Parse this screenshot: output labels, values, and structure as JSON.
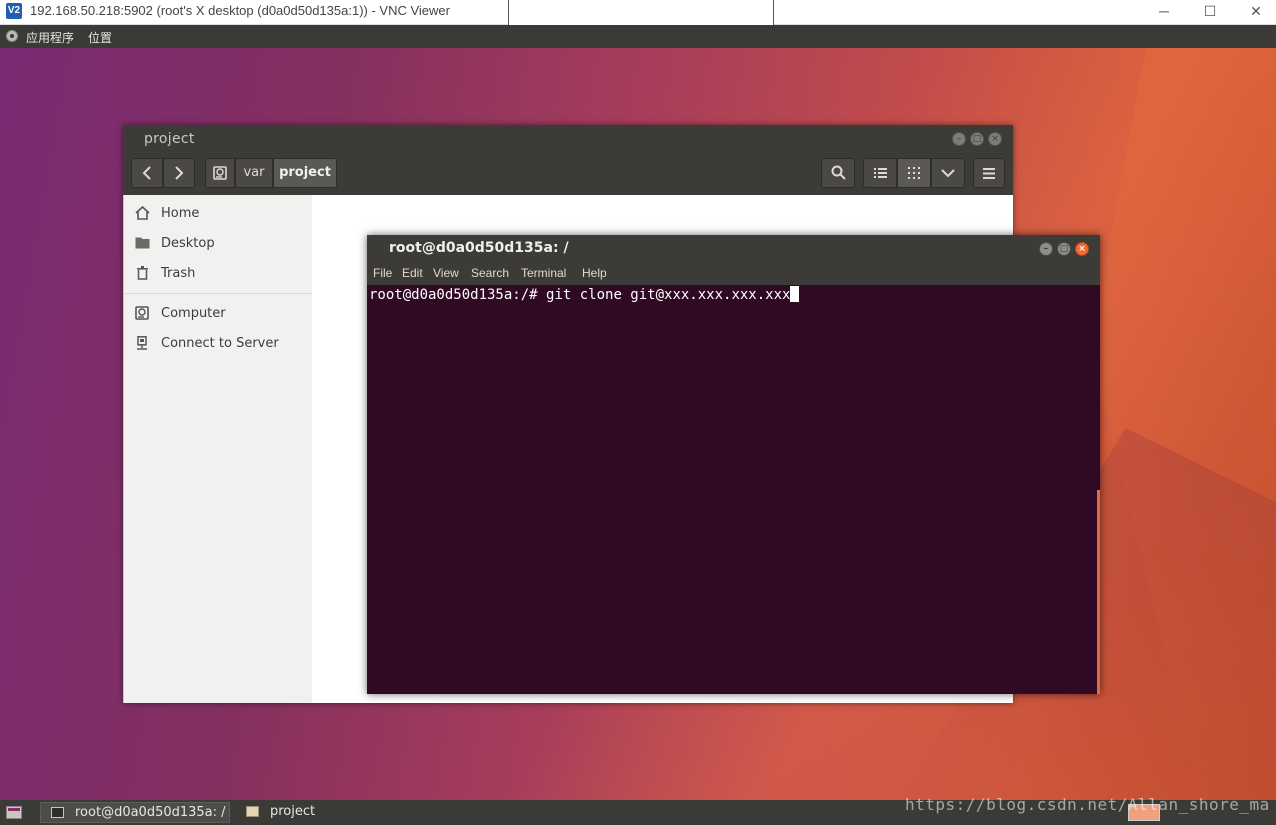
{
  "vnc": {
    "logo": "V2",
    "title": "192.168.50.218:5902 (root's X desktop (d0a0d50d135a:1)) - VNC Viewer",
    "minimize": "─",
    "maximize": "☐",
    "close": "✕"
  },
  "top_panel": {
    "applications": "应用程序",
    "places": "位置"
  },
  "file_manager": {
    "title": "project",
    "path": {
      "segment_1": "var",
      "segment_2": "project"
    },
    "sidebar": [
      {
        "label": "Home",
        "icon": "home-icon"
      },
      {
        "label": "Desktop",
        "icon": "folder-icon"
      },
      {
        "label": "Trash",
        "icon": "trash-icon"
      },
      {
        "label": "Computer",
        "icon": "drive-icon"
      },
      {
        "label": "Connect to Server",
        "icon": "server-icon"
      }
    ]
  },
  "terminal": {
    "title": "root@d0a0d50d135a: /",
    "menu": [
      "File",
      "Edit",
      "View",
      "Search",
      "Terminal",
      "Help"
    ],
    "prompt": "root@d0a0d50d135a:/# ",
    "command": "git clone git@xxx.xxx.xxx.xxx"
  },
  "taskbar": {
    "tasks": [
      {
        "label": "root@d0a0d50d135a: /"
      },
      {
        "label": "project"
      }
    ]
  },
  "watermark": "https://blog.csdn.net/Allan_shore_ma",
  "colors": {
    "terminal_bg": "#300a24",
    "panel_bg": "#3a3a37",
    "close_button": "#f06a35"
  }
}
